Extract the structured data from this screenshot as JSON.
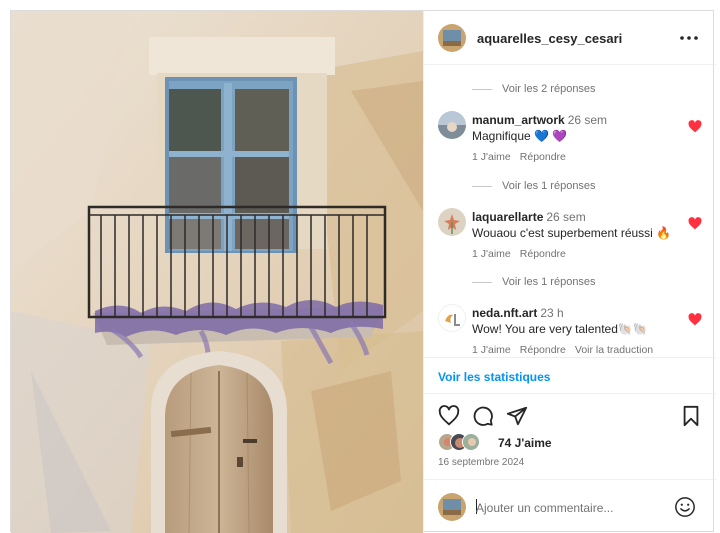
{
  "post": {
    "author": "aquarelles_cesy_cesari",
    "more_icon": "more-horizontal-icon"
  },
  "comments": {
    "replies": [
      {
        "label": "Voir les 2 réponses"
      },
      {
        "label": "Voir les 1 réponses"
      },
      {
        "label": "Voir les 1 réponses"
      }
    ],
    "items": [
      {
        "user": "manum_artwork",
        "time": "26 sem",
        "text": "Magnifique 💙 💜",
        "likes": "1 J'aime",
        "reply": "Répondre",
        "translate": "",
        "liked": true
      },
      {
        "user": "laquarellarte",
        "time": "26 sem",
        "text": "Wouaou c'est superbement réussi 🔥",
        "likes": "1 J'aime",
        "reply": "Répondre",
        "translate": "",
        "liked": true
      },
      {
        "user": "neda.nft.art",
        "time": "23 h",
        "text": "Wow! You are very talented🐚🐚",
        "likes": "1 J'aime",
        "reply": "Répondre",
        "translate": "Voir la traduction",
        "liked": true
      }
    ]
  },
  "stats": {
    "link": "Voir les statistiques"
  },
  "actions": {
    "icons": [
      "heart-outline-icon",
      "comment-icon",
      "share-icon",
      "bookmark-icon"
    ]
  },
  "likes": {
    "count": "74 J'aime"
  },
  "date": "16 septembre 2024",
  "add_comment": {
    "placeholder": "Ajouter un commentaire...",
    "emoji_icon": "emoji-icon"
  },
  "colors": {
    "like_red": "#ff3040",
    "link_blue": "#0095f6",
    "text": "#262626",
    "muted": "#737373"
  }
}
